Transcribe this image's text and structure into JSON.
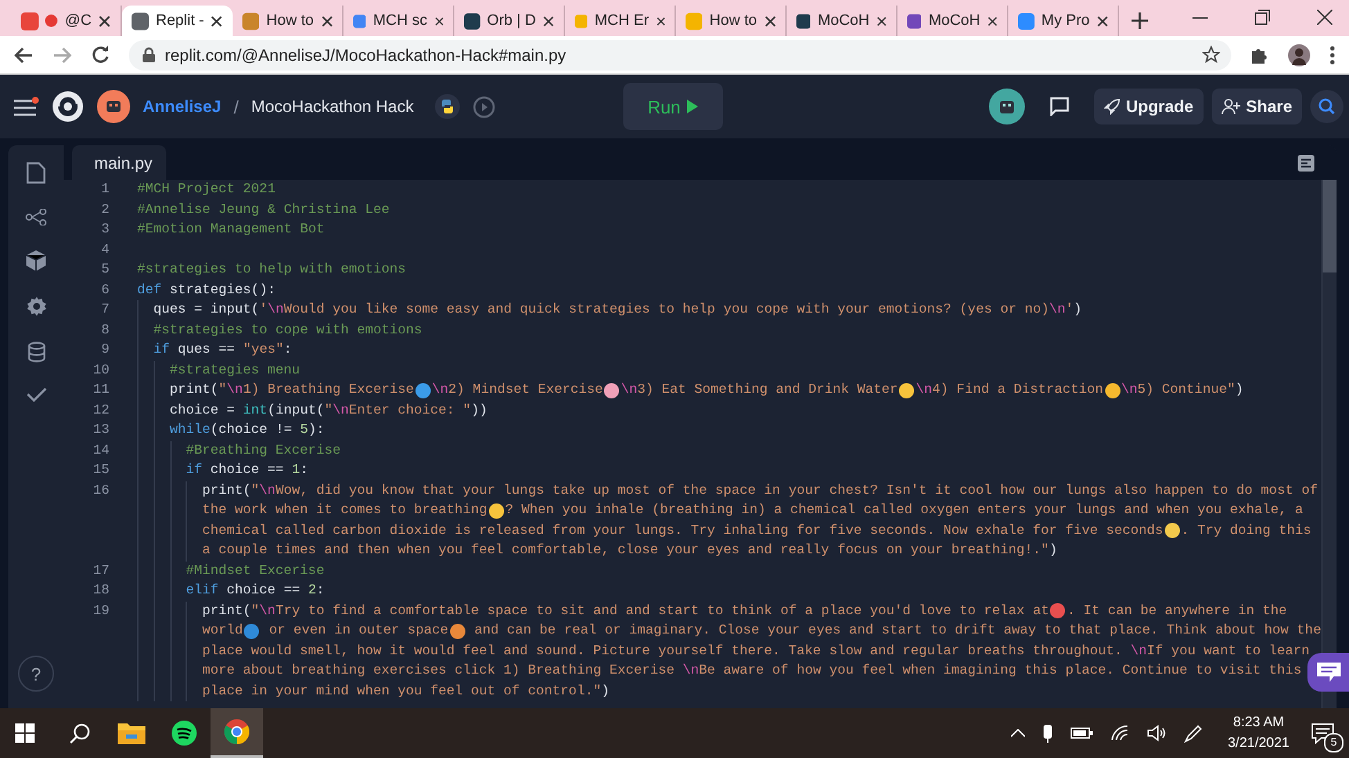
{
  "browser": {
    "tabs": [
      {
        "label": "@C",
        "selected": false,
        "recording": true,
        "color": "#e8453c"
      },
      {
        "label": "Replit -",
        "selected": true,
        "recording": false,
        "color": "#5f6368"
      },
      {
        "label": "How to",
        "selected": false,
        "recording": false,
        "color": "#c9852b"
      },
      {
        "label": "MCH sc",
        "selected": false,
        "recording": false,
        "color": "#4285f4"
      },
      {
        "label": "Orb | D",
        "selected": false,
        "recording": false,
        "color": "#1f3b4d"
      },
      {
        "label": "MCH Er",
        "selected": false,
        "recording": false,
        "color": "#f4b400"
      },
      {
        "label": "How to",
        "selected": false,
        "recording": false,
        "color": "#f4b400"
      },
      {
        "label": "MoCoH",
        "selected": false,
        "recording": false,
        "color": "#1f3b4d"
      },
      {
        "label": "MoCoH",
        "selected": false,
        "recording": false,
        "color": "#7248b9"
      },
      {
        "label": "My Pro",
        "selected": false,
        "recording": false,
        "color": "#2d8cff"
      }
    ],
    "url": "replit.com/@AnneliseJ/MocoHackathon-Hack#main.py"
  },
  "header": {
    "user": "AnneliseJ",
    "separator": "/",
    "repl": "MocoHackathon Hack",
    "run": "Run",
    "upgrade": "Upgrade",
    "share": "Share"
  },
  "editor": {
    "file_tab": "main.py",
    "lines": [
      {
        "n": "1",
        "rows": [
          {
            "tokens": [
              {
                "kind": "comment",
                "t": "#MCH Project 2021"
              }
            ]
          }
        ]
      },
      {
        "n": "2",
        "rows": [
          {
            "tokens": [
              {
                "kind": "comment",
                "t": "#Annelise Jeung & Christina Lee"
              }
            ]
          }
        ]
      },
      {
        "n": "3",
        "rows": [
          {
            "tokens": [
              {
                "kind": "comment",
                "t": "#Emotion Management Bot"
              }
            ]
          }
        ]
      },
      {
        "n": "4",
        "rows": [
          {
            "tokens": []
          }
        ]
      },
      {
        "n": "5",
        "rows": [
          {
            "tokens": [
              {
                "kind": "comment",
                "t": "#strategies to help with emotions"
              }
            ]
          }
        ]
      },
      {
        "n": "6",
        "rows": [
          {
            "tokens": [
              {
                "kind": "keyword",
                "t": "def"
              },
              {
                "kind": "plain",
                "t": " strategies():"
              }
            ]
          }
        ],
        "children": [
          {
            "n": "7",
            "rows": [
              {
                "tokens": [
                  {
                    "kind": "plain",
                    "t": "ques = input("
                  },
                  {
                    "kind": "string",
                    "t": "'"
                  },
                  {
                    "kind": "escape",
                    "t": "\\n"
                  },
                  {
                    "kind": "string",
                    "t": "Would you like some easy and quick strategies to help you cope with your emotions? (yes or no)"
                  },
                  {
                    "kind": "escape",
                    "t": "\\n"
                  },
                  {
                    "kind": "string",
                    "t": "'"
                  },
                  {
                    "kind": "plain",
                    "t": ")"
                  }
                ]
              }
            ]
          },
          {
            "n": "8",
            "rows": [
              {
                "tokens": [
                  {
                    "kind": "comment",
                    "t": "#strategies to cope with emotions"
                  }
                ]
              }
            ]
          },
          {
            "n": "9",
            "rows": [
              {
                "tokens": [
                  {
                    "kind": "keyword",
                    "t": "if"
                  },
                  {
                    "kind": "plain",
                    "t": " ques == "
                  },
                  {
                    "kind": "string",
                    "t": "\"yes\""
                  },
                  {
                    "kind": "plain",
                    "t": ":"
                  }
                ]
              }
            ],
            "children": [
              {
                "n": "10",
                "rows": [
                  {
                    "tokens": [
                      {
                        "kind": "comment",
                        "t": "#strategies menu"
                      }
                    ]
                  }
                ]
              },
              {
                "n": "11",
                "rows": [
                  {
                    "tokens": [
                      {
                        "kind": "plain",
                        "t": "print("
                      },
                      {
                        "kind": "string",
                        "t": "\""
                      },
                      {
                        "kind": "escape",
                        "t": "\\n"
                      },
                      {
                        "kind": "string",
                        "t": "1) Breathing Excerise"
                      },
                      {
                        "kind": "emoji",
                        "color": "#3b9be8"
                      },
                      {
                        "kind": "escape",
                        "t": "\\n"
                      },
                      {
                        "kind": "string",
                        "t": "2) Mindset Exercise"
                      },
                      {
                        "kind": "emoji",
                        "color": "#f0a0b8"
                      },
                      {
                        "kind": "escape",
                        "t": "\\n"
                      },
                      {
                        "kind": "string",
                        "t": "3) Eat Something and Drink Water"
                      },
                      {
                        "kind": "emoji",
                        "color": "#f7c33c"
                      },
                      {
                        "kind": "escape",
                        "t": "\\n"
                      },
                      {
                        "kind": "string",
                        "t": "4) Find a Distraction"
                      },
                      {
                        "kind": "emoji",
                        "color": "#f5b82e"
                      },
                      {
                        "kind": "escape",
                        "t": "\\n"
                      },
                      {
                        "kind": "string",
                        "t": "5) Continue\""
                      },
                      {
                        "kind": "plain",
                        "t": ")"
                      }
                    ]
                  }
                ]
              },
              {
                "n": "12",
                "rows": [
                  {
                    "tokens": [
                      {
                        "kind": "plain",
                        "t": "choice = "
                      },
                      {
                        "kind": "builtin",
                        "t": "int"
                      },
                      {
                        "kind": "plain",
                        "t": "(input("
                      },
                      {
                        "kind": "string",
                        "t": "\""
                      },
                      {
                        "kind": "escape",
                        "t": "\\n"
                      },
                      {
                        "kind": "string",
                        "t": "Enter choice: \""
                      },
                      {
                        "kind": "plain",
                        "t": "))"
                      }
                    ]
                  }
                ]
              },
              {
                "n": "13",
                "rows": [
                  {
                    "tokens": [
                      {
                        "kind": "keyword",
                        "t": "while"
                      },
                      {
                        "kind": "plain",
                        "t": "(choice != "
                      },
                      {
                        "kind": "number",
                        "t": "5"
                      },
                      {
                        "kind": "plain",
                        "t": "):"
                      }
                    ]
                  }
                ],
                "children": [
                  {
                    "n": "14",
                    "rows": [
                      {
                        "tokens": [
                          {
                            "kind": "comment",
                            "t": "#Breathing Excerise"
                          }
                        ]
                      }
                    ]
                  },
                  {
                    "n": "15",
                    "rows": [
                      {
                        "tokens": [
                          {
                            "kind": "keyword",
                            "t": "if"
                          },
                          {
                            "kind": "plain",
                            "t": " choice == "
                          },
                          {
                            "kind": "number",
                            "t": "1"
                          },
                          {
                            "kind": "plain",
                            "t": ":"
                          }
                        ]
                      }
                    ],
                    "children": [
                      {
                        "n": "16",
                        "rows": [
                          {
                            "tokens": [
                              {
                                "kind": "plain",
                                "t": "print("
                              },
                              {
                                "kind": "string",
                                "t": "\""
                              },
                              {
                                "kind": "escape",
                                "t": "\\n"
                              },
                              {
                                "kind": "string",
                                "t": "Wow, did you know that your lungs take up most of the space in your chest? Isn't it cool how our lungs also happen to do most of"
                              }
                            ]
                          },
                          {
                            "tokens": [
                              {
                                "kind": "string",
                                "t": "the work when it comes to breathing"
                              },
                              {
                                "kind": "emoji",
                                "color": "#f7c33c"
                              },
                              {
                                "kind": "string",
                                "t": "? When you inhale (breathing in) a chemical called oxygen enters your lungs and when you exhale, a"
                              }
                            ]
                          },
                          {
                            "tokens": [
                              {
                                "kind": "string",
                                "t": "chemical called carbon dioxide is released from your lungs. Try inhaling for five seconds. Now exhale for five seconds"
                              },
                              {
                                "kind": "emoji",
                                "color": "#f2c94c"
                              },
                              {
                                "kind": "string",
                                "t": ". Try doing this"
                              }
                            ]
                          },
                          {
                            "tokens": [
                              {
                                "kind": "string",
                                "t": "a couple times and then when you feel comfortable, close your eyes and really focus on your breathing!.\""
                              },
                              {
                                "kind": "plain",
                                "t": ")"
                              }
                            ]
                          }
                        ]
                      }
                    ]
                  },
                  {
                    "n": "17",
                    "rows": [
                      {
                        "tokens": [
                          {
                            "kind": "comment",
                            "t": "#Mindset Excerise"
                          }
                        ]
                      }
                    ]
                  },
                  {
                    "n": "18",
                    "rows": [
                      {
                        "tokens": [
                          {
                            "kind": "keyword",
                            "t": "elif"
                          },
                          {
                            "kind": "plain",
                            "t": " choice == "
                          },
                          {
                            "kind": "number",
                            "t": "2"
                          },
                          {
                            "kind": "plain",
                            "t": ":"
                          }
                        ]
                      }
                    ],
                    "children": [
                      {
                        "n": "19",
                        "rows": [
                          {
                            "tokens": [
                              {
                                "kind": "plain",
                                "t": "print("
                              },
                              {
                                "kind": "string",
                                "t": "\""
                              },
                              {
                                "kind": "escape",
                                "t": "\\n"
                              },
                              {
                                "kind": "string",
                                "t": "Try to find a comfortable space to sit and and start to think of a place you'd love to relax at"
                              },
                              {
                                "kind": "emoji",
                                "color": "#e94f4f"
                              },
                              {
                                "kind": "string",
                                "t": ". It can be anywhere in the"
                              }
                            ]
                          },
                          {
                            "tokens": [
                              {
                                "kind": "string",
                                "t": "world"
                              },
                              {
                                "kind": "emoji",
                                "color": "#2f8ad8"
                              },
                              {
                                "kind": "string",
                                "t": " or even in outer space"
                              },
                              {
                                "kind": "emoji",
                                "color": "#e8883a"
                              },
                              {
                                "kind": "string",
                                "t": " and can be real or imaginary. Close your eyes and start to drift away to that place. Think about how the"
                              }
                            ]
                          },
                          {
                            "tokens": [
                              {
                                "kind": "string",
                                "t": "place would smell, how it would feel and sound. Picture yourself there. Take slow and regular breaths throughout. "
                              },
                              {
                                "kind": "escape",
                                "t": "\\n"
                              },
                              {
                                "kind": "string",
                                "t": "If you want to learn"
                              }
                            ]
                          },
                          {
                            "tokens": [
                              {
                                "kind": "string",
                                "t": "more about breathing exercises click 1) Breathing Excerise "
                              },
                              {
                                "kind": "escape",
                                "t": "\\n"
                              },
                              {
                                "kind": "string",
                                "t": "Be aware of how you feel when imagining this place. Continue to visit this"
                              }
                            ]
                          },
                          {
                            "tokens": [
                              {
                                "kind": "string",
                                "t": "place in your mind when you feel out of control.\""
                              },
                              {
                                "kind": "plain",
                                "t": ")"
                              }
                            ]
                          }
                        ]
                      }
                    ]
                  }
                ]
              }
            ]
          }
        ]
      }
    ]
  },
  "help": "?",
  "taskbar": {
    "apps": [
      {
        "kind": "search",
        "selected": false
      },
      {
        "kind": "folder",
        "selected": false
      },
      {
        "kind": "spotify",
        "selected": false
      },
      {
        "kind": "chrome",
        "selected": true
      }
    ],
    "time": "8:23 AM",
    "date": "3/21/2021",
    "notifications": "5"
  }
}
